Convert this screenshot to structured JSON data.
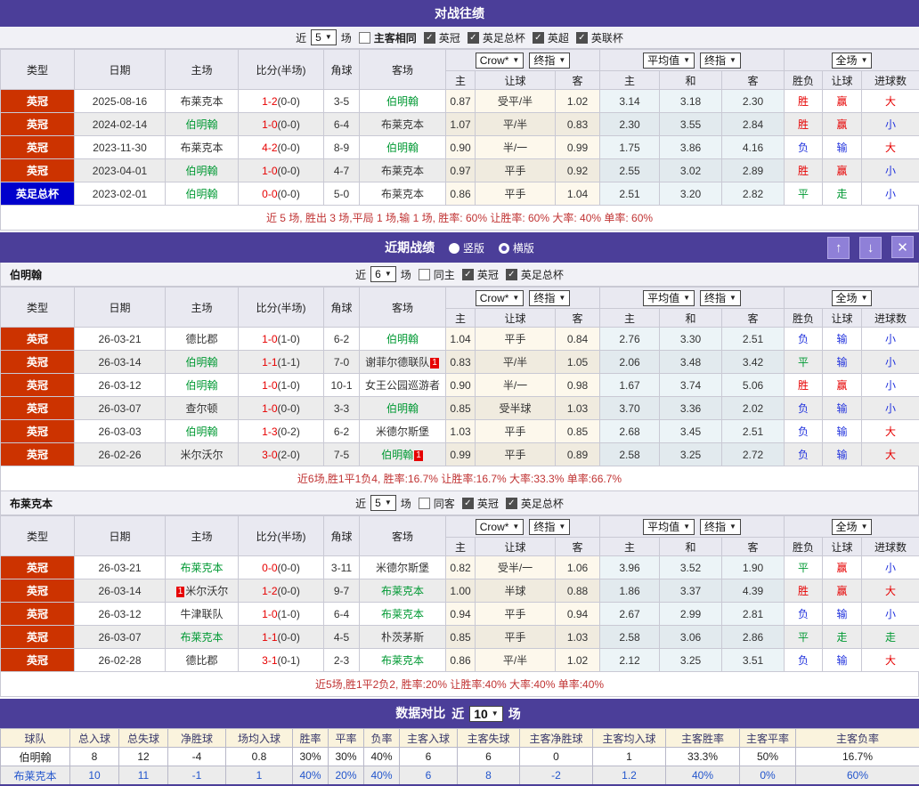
{
  "colors": {
    "purple": "#4b3e99",
    "league_red": "#cc3300",
    "league_blue": "#0000cc",
    "team_green": "#009933",
    "res_red": "#e60000",
    "res_blue": "#2233dd",
    "res_green": "#009933",
    "summary_red": "#c03333",
    "comp_blue": "#2255cc",
    "btn_purple": "#8f80d8"
  },
  "icons": {
    "arrow_up": "↑",
    "arrow_down": "↓",
    "close": "✕",
    "chevron_down": "▼",
    "check": "✓"
  },
  "layout": {
    "match_col_widths": [
      83,
      102,
      82,
      96,
      40,
      97,
      33,
      90,
      50,
      67,
      70,
      70,
      43,
      44,
      65
    ],
    "comp_col_widths": [
      78,
      55,
      55,
      65,
      75,
      40,
      40,
      40,
      65,
      70,
      82,
      82,
      83,
      63,
      139
    ]
  },
  "match_table": {
    "main_headers": [
      "类型",
      "日期",
      "主场",
      "比分(半场)",
      "角球",
      "客场"
    ],
    "odds_group": {
      "select1": "Crow*",
      "select2": "终指"
    },
    "avg_group": {
      "select1": "平均值",
      "select2": "终指"
    },
    "scope_group": {
      "select1": "全场"
    },
    "sub_headers": [
      "主",
      "让球",
      "客",
      "主",
      "和",
      "客",
      "胜负",
      "让球",
      "进球数"
    ]
  },
  "h2h": {
    "title": "对战往绩",
    "filter": {
      "near": "近",
      "games": "5",
      "unit": "场",
      "same": "主客相同",
      "same_checked": false,
      "same_bold": true,
      "leagues": [
        "英冠",
        "英足总杯",
        "英超",
        "英联杯"
      ]
    },
    "rows": [
      {
        "league": "英冠",
        "league_color": "red",
        "date": "2025-08-16",
        "home": {
          "name": "布莱克本"
        },
        "score": "1-2",
        "half": "(0-0)",
        "corners": "3-5",
        "away": {
          "name": "伯明翰",
          "green": true
        },
        "odds": [
          "0.87",
          "受平/半",
          "1.02"
        ],
        "averages": [
          "3.14",
          "3.18",
          "2.30"
        ],
        "results": [
          {
            "t": "胜",
            "c": "red"
          },
          {
            "t": "赢",
            "c": "red"
          },
          {
            "t": "大",
            "c": "red"
          }
        ]
      },
      {
        "league": "英冠",
        "league_color": "red",
        "date": "2024-02-14",
        "home": {
          "name": "伯明翰",
          "green": true
        },
        "score": "1-0",
        "half": "(0-0)",
        "corners": "6-4",
        "away": {
          "name": "布莱克本"
        },
        "odds": [
          "1.07",
          "平/半",
          "0.83"
        ],
        "averages": [
          "2.30",
          "3.55",
          "2.84"
        ],
        "results": [
          {
            "t": "胜",
            "c": "red"
          },
          {
            "t": "赢",
            "c": "red"
          },
          {
            "t": "小",
            "c": "blue"
          }
        ]
      },
      {
        "league": "英冠",
        "league_color": "red",
        "date": "2023-11-30",
        "home": {
          "name": "布莱克本"
        },
        "score": "4-2",
        "half": "(0-0)",
        "corners": "8-9",
        "away": {
          "name": "伯明翰",
          "green": true
        },
        "odds": [
          "0.90",
          "半/一",
          "0.99"
        ],
        "averages": [
          "1.75",
          "3.86",
          "4.16"
        ],
        "results": [
          {
            "t": "负",
            "c": "blue"
          },
          {
            "t": "输",
            "c": "blue"
          },
          {
            "t": "大",
            "c": "red"
          }
        ]
      },
      {
        "league": "英冠",
        "league_color": "red",
        "date": "2023-04-01",
        "home": {
          "name": "伯明翰",
          "green": true
        },
        "score": "1-0",
        "half": "(0-0)",
        "corners": "4-7",
        "away": {
          "name": "布莱克本"
        },
        "odds": [
          "0.97",
          "平手",
          "0.92"
        ],
        "averages": [
          "2.55",
          "3.02",
          "2.89"
        ],
        "results": [
          {
            "t": "胜",
            "c": "red"
          },
          {
            "t": "赢",
            "c": "red"
          },
          {
            "t": "小",
            "c": "blue"
          }
        ]
      },
      {
        "league": "英足总杯",
        "league_color": "blue",
        "date": "2023-02-01",
        "home": {
          "name": "伯明翰",
          "green": true
        },
        "score": "0-0",
        "half": "(0-0)",
        "corners": "5-0",
        "away": {
          "name": "布莱克本"
        },
        "odds": [
          "0.86",
          "平手",
          "1.04"
        ],
        "averages": [
          "2.51",
          "3.20",
          "2.82"
        ],
        "results": [
          {
            "t": "平",
            "c": "green"
          },
          {
            "t": "走",
            "c": "green"
          },
          {
            "t": "小",
            "c": "blue"
          }
        ]
      }
    ],
    "summary": "近 5 场, 胜出 3 场,平局 1 场,输 1 场, 胜率: 60% 让胜率: 60% 大率: 40% 单率: 60%"
  },
  "recent": {
    "title": "近期战绩",
    "layout_options": [
      {
        "label": "竖版",
        "selected": true
      },
      {
        "label": "横版",
        "selected": false
      }
    ],
    "teams": [
      {
        "name": "伯明翰",
        "filter": {
          "near": "近",
          "games": "6",
          "unit": "场",
          "same": "同主",
          "same_checked": false,
          "same_bold": false,
          "leagues": [
            "英冠",
            "英足总杯"
          ]
        },
        "rows": [
          {
            "league": "英冠",
            "league_color": "red",
            "date": "26-03-21",
            "home": {
              "name": "德比郡"
            },
            "score": "1-0",
            "half": "(1-0)",
            "corners": "6-2",
            "away": {
              "name": "伯明翰",
              "green": true
            },
            "odds": [
              "1.04",
              "平手",
              "0.84"
            ],
            "averages": [
              "2.76",
              "3.30",
              "2.51"
            ],
            "results": [
              {
                "t": "负",
                "c": "blue"
              },
              {
                "t": "输",
                "c": "blue"
              },
              {
                "t": "小",
                "c": "blue"
              }
            ]
          },
          {
            "league": "英冠",
            "league_color": "red",
            "date": "26-03-14",
            "home": {
              "name": "伯明翰",
              "green": true
            },
            "score": "1-1",
            "half": "(1-1)",
            "corners": "7-0",
            "away": {
              "name": "谢菲尔德联队",
              "red_card": "1",
              "red_card_pos": "after"
            },
            "odds": [
              "0.83",
              "平/半",
              "1.05"
            ],
            "averages": [
              "2.06",
              "3.48",
              "3.42"
            ],
            "results": [
              {
                "t": "平",
                "c": "green"
              },
              {
                "t": "输",
                "c": "blue"
              },
              {
                "t": "小",
                "c": "blue"
              }
            ]
          },
          {
            "league": "英冠",
            "league_color": "red",
            "date": "26-03-12",
            "home": {
              "name": "伯明翰",
              "green": true
            },
            "score": "1-0",
            "half": "(1-0)",
            "corners": "10-1",
            "away": {
              "name": "女王公园巡游者"
            },
            "odds": [
              "0.90",
              "半/一",
              "0.98"
            ],
            "averages": [
              "1.67",
              "3.74",
              "5.06"
            ],
            "results": [
              {
                "t": "胜",
                "c": "red"
              },
              {
                "t": "赢",
                "c": "red"
              },
              {
                "t": "小",
                "c": "blue"
              }
            ]
          },
          {
            "league": "英冠",
            "league_color": "red",
            "date": "26-03-07",
            "home": {
              "name": "查尔顿"
            },
            "score": "1-0",
            "half": "(0-0)",
            "corners": "3-3",
            "away": {
              "name": "伯明翰",
              "green": true
            },
            "odds": [
              "0.85",
              "受半球",
              "1.03"
            ],
            "averages": [
              "3.70",
              "3.36",
              "2.02"
            ],
            "results": [
              {
                "t": "负",
                "c": "blue"
              },
              {
                "t": "输",
                "c": "blue"
              },
              {
                "t": "小",
                "c": "blue"
              }
            ]
          },
          {
            "league": "英冠",
            "league_color": "red",
            "date": "26-03-03",
            "home": {
              "name": "伯明翰",
              "green": true
            },
            "score": "1-3",
            "half": "(0-2)",
            "corners": "6-2",
            "away": {
              "name": "米德尔斯堡"
            },
            "odds": [
              "1.03",
              "平手",
              "0.85"
            ],
            "averages": [
              "2.68",
              "3.45",
              "2.51"
            ],
            "results": [
              {
                "t": "负",
                "c": "blue"
              },
              {
                "t": "输",
                "c": "blue"
              },
              {
                "t": "大",
                "c": "red"
              }
            ]
          },
          {
            "league": "英冠",
            "league_color": "red",
            "date": "26-02-26",
            "home": {
              "name": "米尔沃尔"
            },
            "score": "3-0",
            "half": "(2-0)",
            "corners": "7-5",
            "away": {
              "name": "伯明翰",
              "green": true,
              "red_card": "1",
              "red_card_pos": "after"
            },
            "odds": [
              "0.99",
              "平手",
              "0.89"
            ],
            "averages": [
              "2.58",
              "3.25",
              "2.72"
            ],
            "results": [
              {
                "t": "负",
                "c": "blue"
              },
              {
                "t": "输",
                "c": "blue"
              },
              {
                "t": "大",
                "c": "red"
              }
            ]
          }
        ],
        "summary": "近6场,胜1平1负4, 胜率:16.7% 让胜率:16.7% 大率:33.3% 单率:66.7%"
      },
      {
        "name": "布莱克本",
        "filter": {
          "near": "近",
          "games": "5",
          "unit": "场",
          "same": "同客",
          "same_checked": false,
          "same_bold": false,
          "leagues": [
            "英冠",
            "英足总杯"
          ]
        },
        "rows": [
          {
            "league": "英冠",
            "league_color": "red",
            "date": "26-03-21",
            "home": {
              "name": "布莱克本",
              "green": true
            },
            "score": "0-0",
            "half": "(0-0)",
            "corners": "3-11",
            "away": {
              "name": "米德尔斯堡"
            },
            "odds": [
              "0.82",
              "受半/一",
              "1.06"
            ],
            "averages": [
              "3.96",
              "3.52",
              "1.90"
            ],
            "results": [
              {
                "t": "平",
                "c": "green"
              },
              {
                "t": "赢",
                "c": "red"
              },
              {
                "t": "小",
                "c": "blue"
              }
            ]
          },
          {
            "league": "英冠",
            "league_color": "red",
            "date": "26-03-14",
            "home": {
              "name": "米尔沃尔",
              "red_card": "1",
              "red_card_pos": "before"
            },
            "score": "1-2",
            "half": "(0-0)",
            "corners": "9-7",
            "away": {
              "name": "布莱克本",
              "green": true
            },
            "odds": [
              "1.00",
              "半球",
              "0.88"
            ],
            "averages": [
              "1.86",
              "3.37",
              "4.39"
            ],
            "results": [
              {
                "t": "胜",
                "c": "red"
              },
              {
                "t": "赢",
                "c": "red"
              },
              {
                "t": "大",
                "c": "red"
              }
            ]
          },
          {
            "league": "英冠",
            "league_color": "red",
            "date": "26-03-12",
            "home": {
              "name": "牛津联队"
            },
            "score": "1-0",
            "half": "(1-0)",
            "corners": "6-4",
            "away": {
              "name": "布莱克本",
              "green": true
            },
            "odds": [
              "0.94",
              "平手",
              "0.94"
            ],
            "averages": [
              "2.67",
              "2.99",
              "2.81"
            ],
            "results": [
              {
                "t": "负",
                "c": "blue"
              },
              {
                "t": "输",
                "c": "blue"
              },
              {
                "t": "小",
                "c": "blue"
              }
            ]
          },
          {
            "league": "英冠",
            "league_color": "red",
            "date": "26-03-07",
            "home": {
              "name": "布莱克本",
              "green": true
            },
            "score": "1-1",
            "half": "(0-0)",
            "corners": "4-5",
            "away": {
              "name": "朴茨茅斯"
            },
            "odds": [
              "0.85",
              "平手",
              "1.03"
            ],
            "averages": [
              "2.58",
              "3.06",
              "2.86"
            ],
            "results": [
              {
                "t": "平",
                "c": "green"
              },
              {
                "t": "走",
                "c": "green"
              },
              {
                "t": "走",
                "c": "green"
              }
            ]
          },
          {
            "league": "英冠",
            "league_color": "red",
            "date": "26-02-28",
            "home": {
              "name": "德比郡"
            },
            "score": "3-1",
            "half": "(0-1)",
            "corners": "2-3",
            "away": {
              "name": "布莱克本",
              "green": true
            },
            "odds": [
              "0.86",
              "平/半",
              "1.02"
            ],
            "averages": [
              "2.12",
              "3.25",
              "3.51"
            ],
            "results": [
              {
                "t": "负",
                "c": "blue"
              },
              {
                "t": "输",
                "c": "blue"
              },
              {
                "t": "大",
                "c": "red"
              }
            ]
          }
        ],
        "summary": "近5场,胜1平2负2, 胜率:20% 让胜率:40% 大率:40% 单率:40%"
      }
    ]
  },
  "comparison": {
    "title": "数据对比",
    "near": "近",
    "games": "10",
    "unit": "场",
    "headers": [
      "球队",
      "总入球",
      "总失球",
      "净胜球",
      "场均入球",
      "胜率",
      "平率",
      "负率",
      "主客入球",
      "主客失球",
      "主客净胜球",
      "主客均入球",
      "主客胜率",
      "主客平率",
      "主客负率"
    ],
    "rows": [
      {
        "team": "伯明翰",
        "values": [
          "8",
          "12",
          "-4",
          "0.8",
          "30%",
          "30%",
          "40%",
          "6",
          "6",
          "0",
          "1",
          "33.3%",
          "50%",
          "16.7%"
        ]
      },
      {
        "team": "布莱克本",
        "values": [
          "10",
          "11",
          "-1",
          "1",
          "40%",
          "20%",
          "40%",
          "6",
          "8",
          "-2",
          "1.2",
          "40%",
          "0%",
          "60%"
        ],
        "highlight": "blue"
      }
    ]
  }
}
